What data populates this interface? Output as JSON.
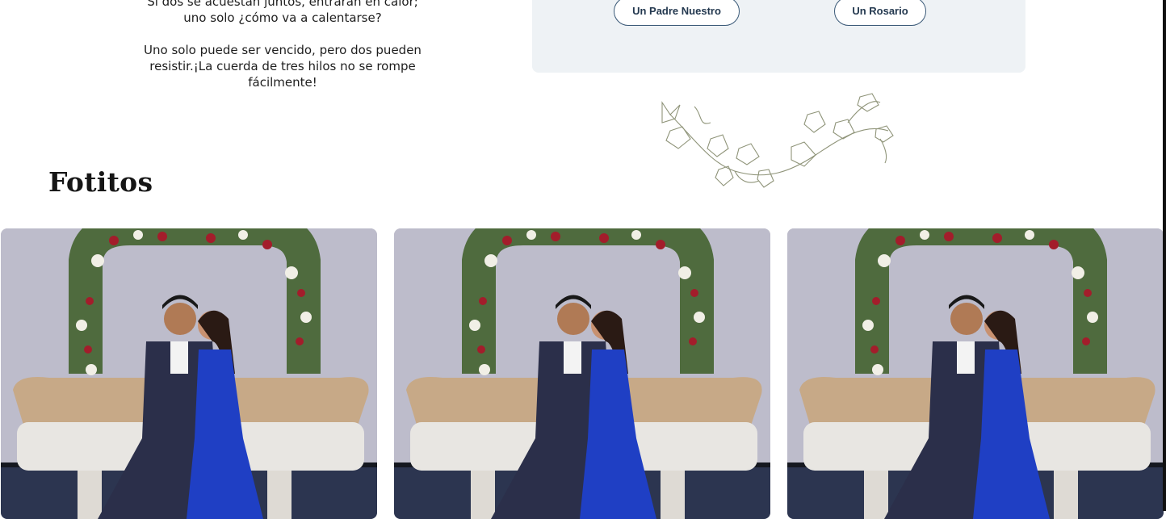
{
  "verse": {
    "paragraph_1": "Si dos se acuestan juntos, entrarán en calor; uno solo ¿cómo va a calentarse?",
    "paragraph_2": "Uno solo puede ser vencido, pero dos pueden resistir.¡La cuerda de tres hilos no se rompe fácilmente!"
  },
  "prayers": {
    "padre_label": "Un Padre Nuestro",
    "rosario_label": "Un Rosario"
  },
  "gallery": {
    "title": "Fotitos",
    "photos": [
      {
        "alt": "Pareja en sofá frente a arco floral"
      },
      {
        "alt": "Pareja en sofá frente a arco floral"
      },
      {
        "alt": "Pareja en sofá frente a arco floral"
      }
    ]
  },
  "colors": {
    "card_bg": "#eef2f5",
    "button_border": "#3b5a78",
    "dress_blue": "#1f3fc4",
    "suit_navy": "#2b2f4a"
  }
}
